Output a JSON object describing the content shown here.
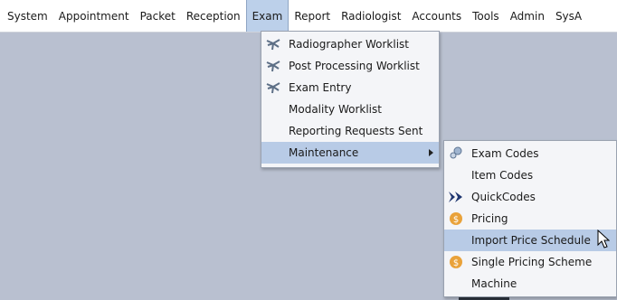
{
  "menubar": {
    "items": [
      "System",
      "Appointment",
      "Packet",
      "Reception",
      "Exam",
      "Report",
      "Radiologist",
      "Accounts",
      "Tools",
      "Admin",
      "SysA"
    ]
  },
  "exam_menu": {
    "items": [
      "Radiographer Worklist",
      "Post Processing Worklist",
      "Exam Entry",
      "Modality Worklist",
      "Reporting Requests Sent",
      "Maintenance"
    ]
  },
  "maintenance_menu": {
    "items": [
      "Exam Codes",
      "Item Codes",
      "QuickCodes",
      "Pricing",
      "Import Price Schedule",
      "Single Pricing Scheme",
      "Machine"
    ]
  },
  "colors": {
    "highlight": "#b8cbe6",
    "desktop": "#b9c0d0",
    "coin": "#e9a23a"
  }
}
